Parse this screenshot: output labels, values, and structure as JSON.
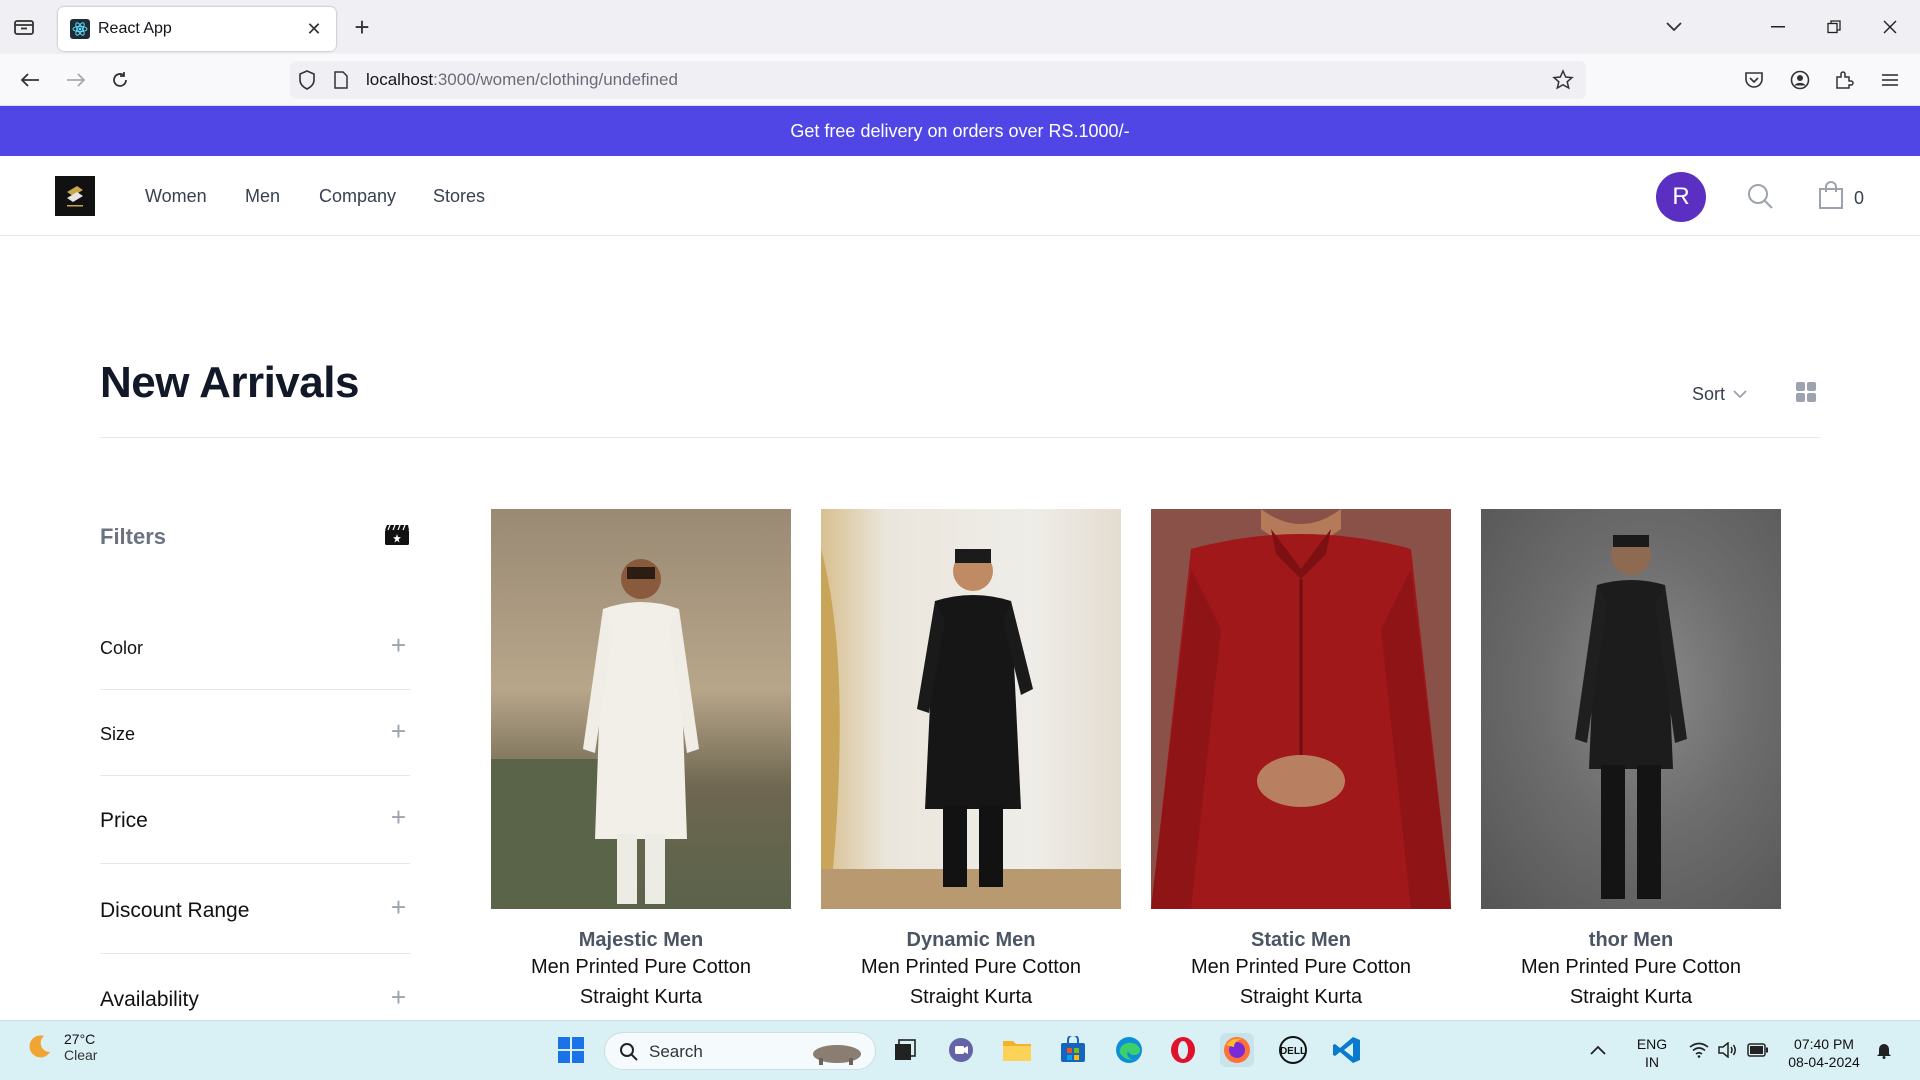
{
  "browser": {
    "tab_title": "React App",
    "url_host": "localhost",
    "url_path": ":3000/women/clothing/undefined"
  },
  "banner": {
    "text": "Get free delivery on orders over RS.1000/-"
  },
  "header": {
    "nav": [
      "Women",
      "Men",
      "Company",
      "Stores"
    ],
    "avatar_letter": "R",
    "cart_count": "0"
  },
  "page": {
    "title": "New Arrivals",
    "sort_label": "Sort"
  },
  "filters": {
    "title": "Filters",
    "sections": [
      "Color",
      "Size",
      "Price",
      "Discount Range",
      "Availability"
    ]
  },
  "products": [
    {
      "brand": "Majestic Men",
      "line1": "Men Printed Pure Cotton",
      "line2": "Straight Kurta",
      "color": "#f0ede6"
    },
    {
      "brand": "Dynamic Men",
      "line1": "Men Printed Pure Cotton",
      "line2": "Straight Kurta",
      "color": "#141414"
    },
    {
      "brand": "Static Men",
      "line1": "Men Printed Pure Cotton",
      "line2": "Straight Kurta",
      "color": "#9e1b1b"
    },
    {
      "brand": "thor Men",
      "line1": "Men Printed Pure Cotton",
      "line2": "Straight Kurta",
      "color": "#1c1c1e"
    }
  ],
  "taskbar": {
    "temp": "27°C",
    "condition": "Clear",
    "search_label": "Search",
    "lang1": "ENG",
    "lang2": "IN",
    "time": "07:40 PM",
    "date": "08-04-2024"
  }
}
